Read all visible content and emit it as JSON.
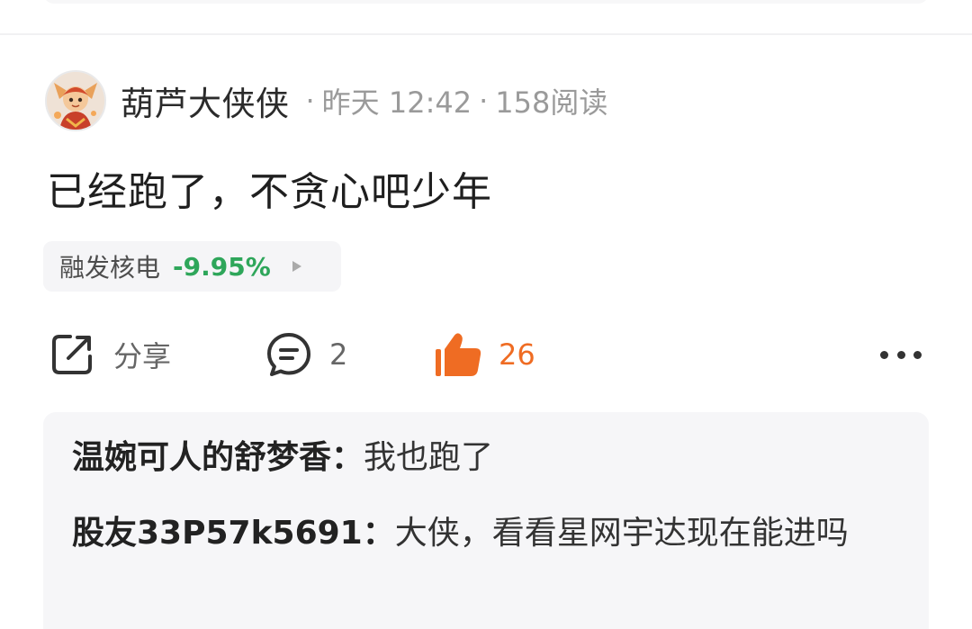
{
  "author": {
    "name": "葫芦大侠侠",
    "time": "昨天 12:42",
    "reads": "158阅读",
    "separator": "·"
  },
  "post": {
    "text": "已经跑了，不贪心吧少年"
  },
  "stock_tag": {
    "name": "融发核电",
    "change": "-9.95%"
  },
  "actions": {
    "share_label": "分享",
    "comment_count": "2",
    "like_count": "26"
  },
  "comments": [
    {
      "author": "温婉可人的舒梦香：",
      "text": "我也跑了"
    },
    {
      "author": "股友33P57k5691：",
      "text": "大侠，看看星网宇达现在能进吗"
    }
  ],
  "colors": {
    "stock_down": "#2ea65a",
    "like_active": "#ef6c23",
    "meta_gray": "#9a9a9a"
  }
}
